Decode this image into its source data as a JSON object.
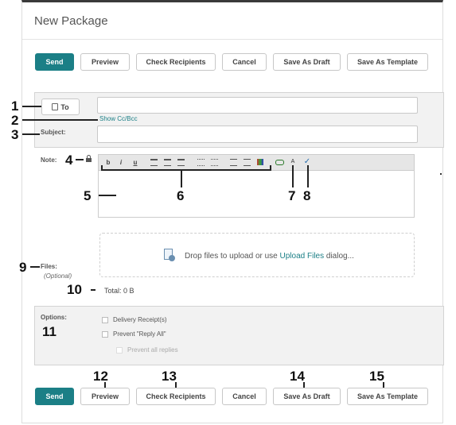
{
  "title": "New Package",
  "buttons": {
    "send": "Send",
    "preview": "Preview",
    "check_recipients": "Check Recipients",
    "cancel": "Cancel",
    "save_draft": "Save As Draft",
    "save_template": "Save As Template"
  },
  "recipients": {
    "to_label": "To",
    "to_value": "",
    "show_cc_bcc": "Show Cc/Bcc",
    "subject_label": "Subject:",
    "subject_value": ""
  },
  "note": {
    "label": "Note:",
    "toolbar": {
      "bold": "b",
      "italic": "i",
      "underline": "u",
      "spell": "A"
    }
  },
  "files": {
    "label": "Files:",
    "optional": "(Optional)",
    "drop_text": "Drop files to upload or use",
    "upload_link": "Upload Files",
    "dialog_suffix": "dialog...",
    "total": "Total: 0 B"
  },
  "options": {
    "label": "Options:",
    "delivery_receipt": "Delivery Receipt(s)",
    "prevent_reply_all": "Prevent \"Reply All\"",
    "prevent_all_replies": "Prevent all replies"
  },
  "callouts": [
    "1",
    "2",
    "3",
    "4",
    "5",
    "6",
    "7",
    "8",
    "9",
    "10",
    "11",
    "12",
    "13",
    "14",
    "15"
  ],
  "colors": {
    "primary": "#1b7f86",
    "link": "#1b7f86"
  }
}
